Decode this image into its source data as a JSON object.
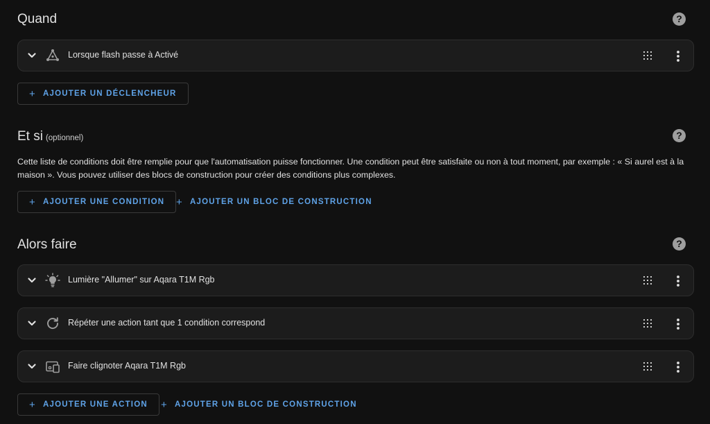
{
  "sections": {
    "when": {
      "title": "Quand",
      "triggers": [
        {
          "label": "Lorsque flash passe à Activé"
        }
      ],
      "add_trigger_label": "AJOUTER UN DÉCLENCHEUR"
    },
    "and_if": {
      "title": "Et si",
      "optional": "(optionnel)",
      "description": "Cette liste de conditions doit être remplie pour que l'automatisation puisse fonctionner. Une condition peut être satisfaite ou non à tout moment, par exemple : « Si aurel est à la maison ». Vous pouvez utiliser des blocs de construction pour créer des conditions plus complexes.",
      "add_condition_label": "AJOUTER UNE CONDITION",
      "add_building_block_label": "AJOUTER UN BLOC DE CONSTRUCTION"
    },
    "then_do": {
      "title": "Alors faire",
      "actions": [
        {
          "label": "Lumière \"Allumer\" sur Aqara T1M Rgb"
        },
        {
          "label": "Répéter une action tant que 1 condition correspond"
        },
        {
          "label": "Faire clignoter Aqara T1M Rgb"
        }
      ],
      "add_action_label": "AJOUTER UNE ACTION",
      "add_building_block_label": "AJOUTER UN BLOC DE CONSTRUCTION"
    }
  },
  "help_glyph": "?",
  "plus_glyph": "+",
  "icons": {
    "trigger": "state-trigger-icon",
    "action1": "lightbulb-icon",
    "action2": "repeat-icon",
    "action3": "device-icon"
  },
  "colors": {
    "background": "#111111",
    "card": "#1c1c1c",
    "accent": "#5fa3e8",
    "text": "#e1e1e1",
    "icon": "#9e9e9e"
  }
}
